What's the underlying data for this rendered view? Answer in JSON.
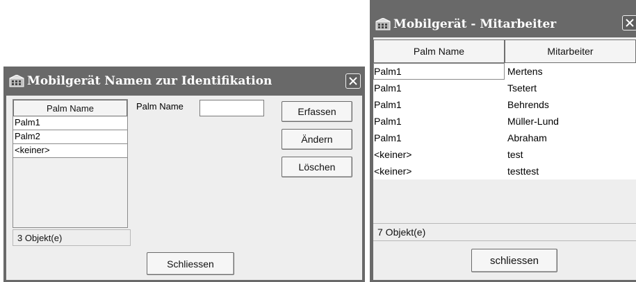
{
  "dialog1": {
    "title": "Mobilgerät Namen zur Identifikation",
    "list_header": "Palm Name",
    "rows": [
      "Palm1",
      "Palm2",
      "<keiner>"
    ],
    "status": "3 Objekt(e)",
    "field_label": "Palm Name",
    "field_value": "",
    "buttons": {
      "add": "Erfassen",
      "edit": "Ändern",
      "delete": "Löschen",
      "close": "Schliessen"
    }
  },
  "dialog2": {
    "title": "Mobilgerät - Mitarbeiter",
    "headers": [
      "Palm Name",
      "Mitarbeiter"
    ],
    "rows": [
      {
        "palm": "Palm1",
        "employee": "Mertens"
      },
      {
        "palm": "Palm1",
        "employee": "Tsetert"
      },
      {
        "palm": "Palm1",
        "employee": "Behrends"
      },
      {
        "palm": "Palm1",
        "employee": "Müller-Lund"
      },
      {
        "palm": "Palm1",
        "employee": "Abraham"
      },
      {
        "palm": "<keiner>",
        "employee": "test"
      },
      {
        "palm": "<keiner>",
        "employee": "testtest"
      }
    ],
    "status": "7 Objekt(e)",
    "buttons": {
      "close": "schliessen"
    }
  }
}
